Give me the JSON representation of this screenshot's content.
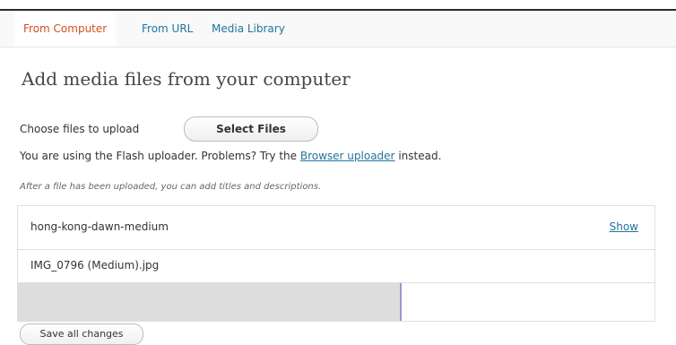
{
  "tabs": [
    {
      "label": "From Computer",
      "active": true
    },
    {
      "label": "From URL",
      "active": false
    },
    {
      "label": "Media Library",
      "active": false
    }
  ],
  "heading": "Add media files from your computer",
  "upload": {
    "choose_label": "Choose files to upload",
    "select_button": "Select Files",
    "flash_text_before": "You are using the Flash uploader. Problems? Try the ",
    "flash_link": "Browser uploader",
    "flash_text_after": " instead.",
    "note": "After a file has been uploaded, you can add titles and descriptions."
  },
  "item": {
    "title": "hong-kong-dawn-medium",
    "show_link": "Show",
    "original_filename": "IMG_0796 (Medium).jpg",
    "progress_fraction": 0.6
  },
  "save_button": "Save all changes",
  "colors": {
    "active_tab": "#d54e21",
    "link": "#21759b"
  }
}
